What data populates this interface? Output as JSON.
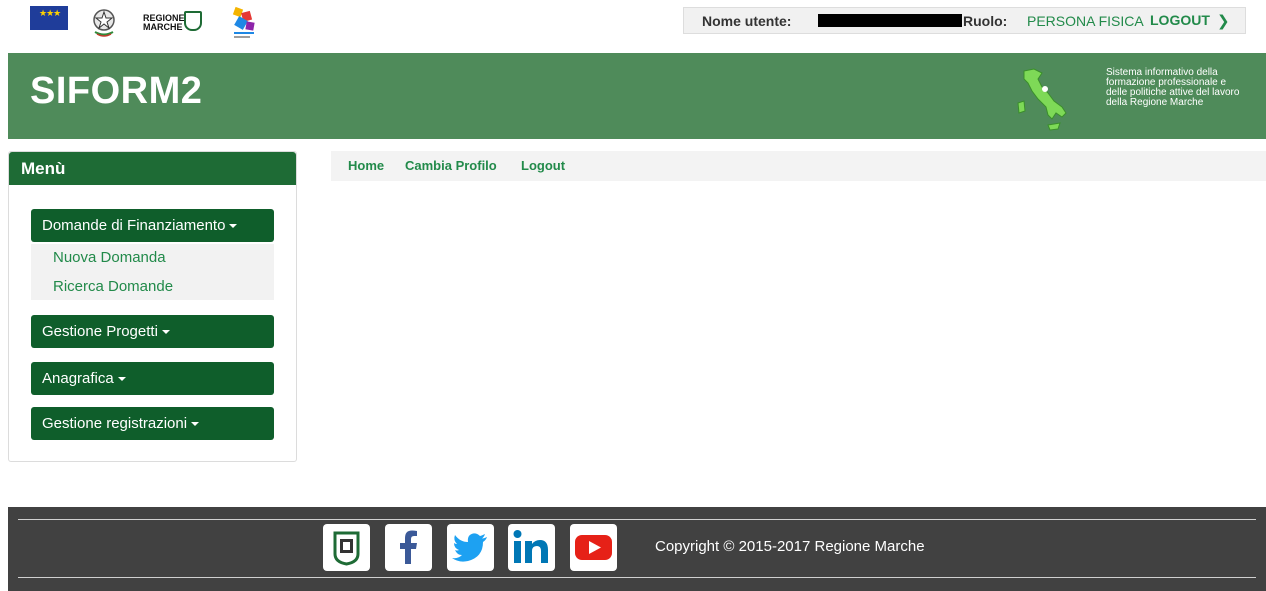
{
  "topbar": {
    "user_label": "Nome utente:",
    "role_label": "Ruolo:",
    "role_value": "PERSONA FISICA",
    "logout_label": "LOGOUT",
    "logo_regione_line1": "REGIONE",
    "logo_regione_line2": "MARCHE"
  },
  "header": {
    "title": "SIFORM2",
    "description": "Sistema informativo della formazione professionale e delle politiche attive del lavoro della Regione Marche",
    "header_color": "#4f8b5a"
  },
  "sidebar": {
    "title": "Menù",
    "menus": [
      {
        "label": "Domande di Finanziamento",
        "expanded": true
      },
      {
        "label": "Gestione Progetti",
        "expanded": false
      },
      {
        "label": "Anagrafica",
        "expanded": false
      },
      {
        "label": "Gestione registrazioni",
        "expanded": false
      }
    ],
    "submenu": [
      "Nuova Domanda",
      "Ricerca Domande"
    ]
  },
  "nav": {
    "home": "Home",
    "cambia_profilo": "Cambia Profilo",
    "logout": "Logout"
  },
  "footer": {
    "copyright": "Copyright © 2015-2017 Regione Marche",
    "social_icons": [
      "regione-marche-icon",
      "facebook-icon",
      "twitter-icon",
      "linkedin-icon",
      "youtube-icon"
    ]
  },
  "colors": {
    "accent": "#228a4a",
    "menu_dark": "#0f5e2b",
    "footer_bg": "#414141"
  }
}
